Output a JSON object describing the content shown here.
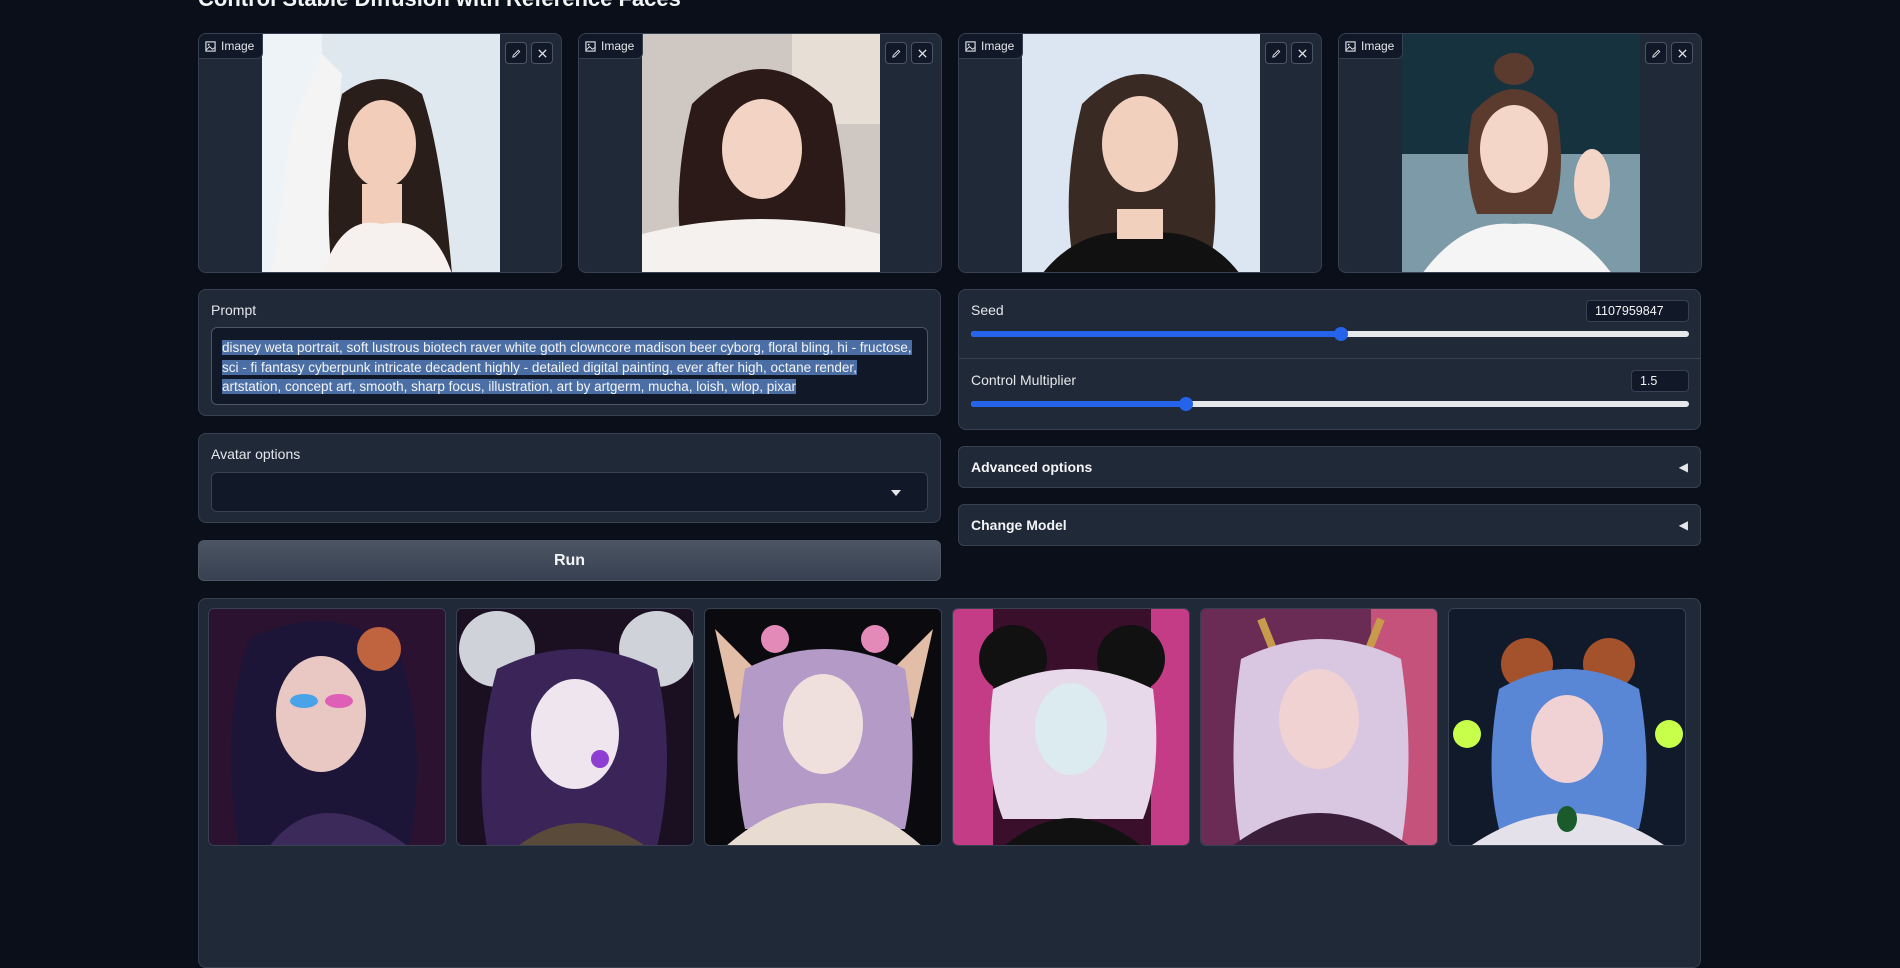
{
  "page": {
    "title": "Control Stable Diffusion with Reference Faces"
  },
  "reference_images": [
    {
      "label": "Image",
      "edit_icon": "pencil-icon",
      "close_icon": "close-icon"
    },
    {
      "label": "Image",
      "edit_icon": "pencil-icon",
      "close_icon": "close-icon"
    },
    {
      "label": "Image",
      "edit_icon": "pencil-icon",
      "close_icon": "close-icon"
    },
    {
      "label": "Image",
      "edit_icon": "pencil-icon",
      "close_icon": "close-icon"
    }
  ],
  "prompt": {
    "label": "Prompt",
    "value": "disney weta portrait, soft lustrous biotech raver white goth clowncore madison beer cyborg, floral bling, hi - fructose, sci - fi fantasy cyberpunk intricate decadent highly - detailed digital painting, ever after high, octane render, artstation, concept art, smooth, sharp focus, illustration, art by artgerm, mucha, loish, wlop, pixar"
  },
  "avatar_options": {
    "label": "Avatar options",
    "value": ""
  },
  "run_button": {
    "label": "Run"
  },
  "seed": {
    "label": "Seed",
    "value": "1107959847",
    "fraction": 0.516
  },
  "control_multiplier": {
    "label": "Control Multiplier",
    "value": "1.5",
    "fraction": 0.3
  },
  "advanced_options": {
    "label": "Advanced options",
    "arrow": "◀"
  },
  "change_model": {
    "label": "Change Model",
    "arrow": "◀"
  },
  "colors": {
    "accent": "#2563eb",
    "panel": "#1f2937",
    "background": "#0b0f19"
  }
}
